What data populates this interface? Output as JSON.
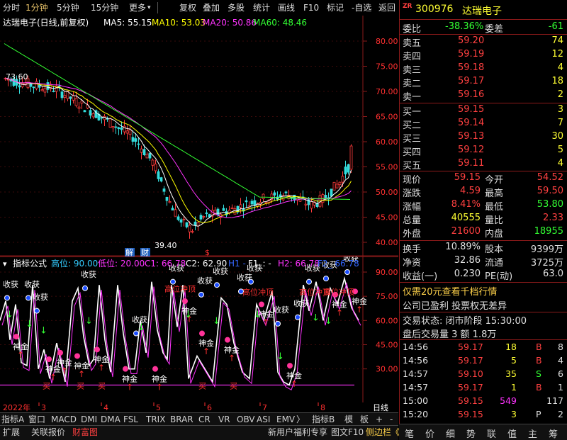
{
  "toolbar": {
    "left": [
      "分时",
      "1分钟",
      "5分钟",
      "15分钟",
      "更多",
      "▾"
    ],
    "right": [
      "复权",
      "叠加",
      "多股",
      "统计",
      "画线",
      "F10",
      "标记",
      "-自选",
      "返回"
    ]
  },
  "main_chart": {
    "title": "达瑞电子(日线,前复权)",
    "ma": [
      {
        "label": "MA5: 55.15",
        "color": "#ffffff"
      },
      {
        "label": "MA10: 53.03",
        "color": "#ffff00"
      },
      {
        "label": "MA20: 50.86",
        "color": "#ff33ff"
      },
      {
        "label": "MA60: 48.46",
        "color": "#33ff33"
      }
    ],
    "ylabels": [
      "80.00",
      "75.00",
      "70.00",
      "65.00",
      "60.00",
      "55.00",
      "50.00",
      "45.00",
      "40.00"
    ],
    "high_mark": "73.60",
    "low_mark": "39.40",
    "badges": [
      "解",
      "财",
      "$"
    ]
  },
  "indicator": {
    "title": "指标公式",
    "params": [
      {
        "label": "高位: 90.00",
        "color": "#33ccff"
      },
      {
        "label": "低位: 20.00",
        "color": "#ff33ff"
      },
      {
        "label": "C1: 66.78",
        "color": "#ff33ff"
      },
      {
        "label": "C2: 62.90",
        "color": "#ffffff"
      },
      {
        "label": "H1  -",
        "color": "#3366ff"
      },
      {
        "label": "F1_: -",
        "color": "#ffffff"
      },
      {
        "label": "H2: 66.78",
        "color": "#ff33ff"
      },
      {
        "label": "F2_  66.78",
        "color": "#3366ff"
      }
    ],
    "ylabels": [
      "90.00",
      "75.00",
      "60.00",
      "45.00",
      "30.00"
    ],
    "word_shougou": "收获",
    "word_shenjin": "神金",
    "word_mai": "买",
    "word_red": "高位冲顶"
  },
  "xaxis": {
    "labels": [
      "2022年",
      "3",
      "4",
      "5",
      "6",
      "7",
      "8"
    ],
    "period": "日线"
  },
  "tabs": [
    "指标A",
    "窗口",
    "MACD",
    "DMI",
    "DMA",
    "FSL",
    "TRIX",
    "BRAR",
    "CR",
    "VR",
    "OBV",
    "ASI",
    "EMV",
    "〉",
    "指标B",
    "模",
    "板",
    "+",
    "-"
  ],
  "bottombar": {
    "left": [
      "扩展",
      "关联报价",
      "财富图"
    ],
    "right": [
      "新用户福利专享",
      "图文F10",
      "侧边栏《"
    ]
  },
  "quote": {
    "code": "300976",
    "name": "达瑞电子",
    "tag": "ZR",
    "weibi_label": "委比",
    "weibi": "-38.36%",
    "weicha_label": "委差",
    "weicha": "-61",
    "sells": [
      {
        "label": "卖五",
        "price": "59.20",
        "vol": "74"
      },
      {
        "label": "卖四",
        "price": "59.19",
        "vol": "12"
      },
      {
        "label": "卖三",
        "price": "59.18",
        "vol": "4"
      },
      {
        "label": "卖二",
        "price": "59.17",
        "vol": "18"
      },
      {
        "label": "卖一",
        "price": "59.16",
        "vol": "2"
      }
    ],
    "buys": [
      {
        "label": "买一",
        "price": "59.15",
        "vol": "3"
      },
      {
        "label": "买二",
        "price": "59.14",
        "vol": "7"
      },
      {
        "label": "买三",
        "price": "59.13",
        "vol": "30"
      },
      {
        "label": "买四",
        "price": "59.12",
        "vol": "5"
      },
      {
        "label": "买五",
        "price": "59.11",
        "vol": "4"
      }
    ],
    "stats": [
      {
        "l1": "现价",
        "v1": "59.15",
        "c1": "red",
        "l2": "今开",
        "v2": "54.52",
        "c2": "red"
      },
      {
        "l1": "涨跌",
        "v1": "4.59",
        "c1": "red",
        "l2": "最高",
        "v2": "59.50",
        "c2": "red"
      },
      {
        "l1": "涨幅",
        "v1": "8.41%",
        "c1": "red",
        "l2": "最低",
        "v2": "53.80",
        "c2": "green"
      },
      {
        "l1": "总量",
        "v1": "40555",
        "c1": "yellow",
        "l2": "量比",
        "v2": "2.33",
        "c2": "red"
      },
      {
        "l1": "外盘",
        "v1": "21600",
        "c1": "red",
        "l2": "内盘",
        "v2": "18955",
        "c2": "green"
      }
    ],
    "stats2": [
      {
        "l1": "换手",
        "v1": "10.89%",
        "l2": "股本",
        "v2": "9399万"
      },
      {
        "l1": "净资",
        "v1": "32.86",
        "l2": "流通",
        "v2": "3725万"
      },
      {
        "l1": "收益(一)",
        "v1": "0.230",
        "l2": "PE(动)",
        "v2": "63.0"
      }
    ],
    "promo": "仅需20元查看千档行情",
    "profit": "公司已盈利 投票权无差异",
    "status": "交易状态: 闭市阶段 15:30:00",
    "after": "盘后交易量 3 额 1.8万",
    "trades": [
      {
        "t": "14:56",
        "p": "59.17",
        "v": "18",
        "s": "B",
        "n": "8",
        "vc": "yellow",
        "sc": "red"
      },
      {
        "t": "14:56",
        "p": "59.17",
        "v": "5",
        "s": "B",
        "n": "4",
        "vc": "yellow",
        "sc": "red"
      },
      {
        "t": "14:57",
        "p": "59.10",
        "v": "35",
        "s": "S",
        "n": "6",
        "vc": "yellow",
        "sc": "green"
      },
      {
        "t": "14:57",
        "p": "59.17",
        "v": "1",
        "s": "B",
        "n": "1",
        "vc": "yellow",
        "sc": "red"
      },
      {
        "t": "15:00",
        "p": "59.15",
        "v": "549",
        "s": "",
        "n": "117",
        "vc": "magenta",
        "sc": "white"
      },
      {
        "t": "15:20",
        "p": "59.15",
        "v": "3",
        "s": "P",
        "n": "2",
        "vc": "yellow",
        "sc": "white"
      }
    ],
    "bottom_tabs": [
      "笔",
      "价",
      "细",
      "势",
      "联",
      "值",
      "主",
      "筹"
    ]
  },
  "colors": {
    "up": "#ff3b3b",
    "down": "#33dddd",
    "ma5": "#ffffff",
    "ma10": "#ffff00",
    "ma20": "#ff33ff",
    "ma60": "#33ff33"
  }
}
